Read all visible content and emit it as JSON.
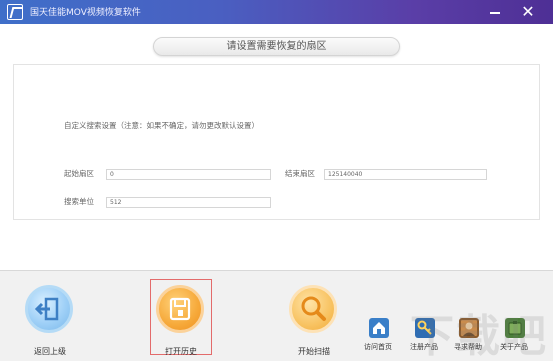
{
  "window": {
    "title": "国天佳能MOV视频恢复软件",
    "minimize_icon": "minimize-icon",
    "close_glyph": "✕"
  },
  "header": {
    "title": "请设置需要恢复的扇区"
  },
  "settings": {
    "note": "自定义搜索设置（注意：如果不确定，请勿更改默认设置）",
    "start_sector_label": "起始扇区",
    "start_sector_value": "0",
    "end_sector_label": "结束扇区",
    "end_sector_value": "125140040",
    "search_unit_label": "搜索单位",
    "search_unit_value": "512"
  },
  "toolbar": {
    "back_label": "返回上级",
    "open_history_label": "打开历史",
    "start_scan_label": "开始扫描",
    "visit_home_label": "访问首页",
    "register_label": "注册产品",
    "help_label": "寻求帮助",
    "about_label": "关于产品"
  },
  "colors": {
    "titlebar_start": "#3f6fc9",
    "titlebar_end": "#4e2f95",
    "history_frame": "#e36b6b"
  },
  "watermark": "下载吧"
}
